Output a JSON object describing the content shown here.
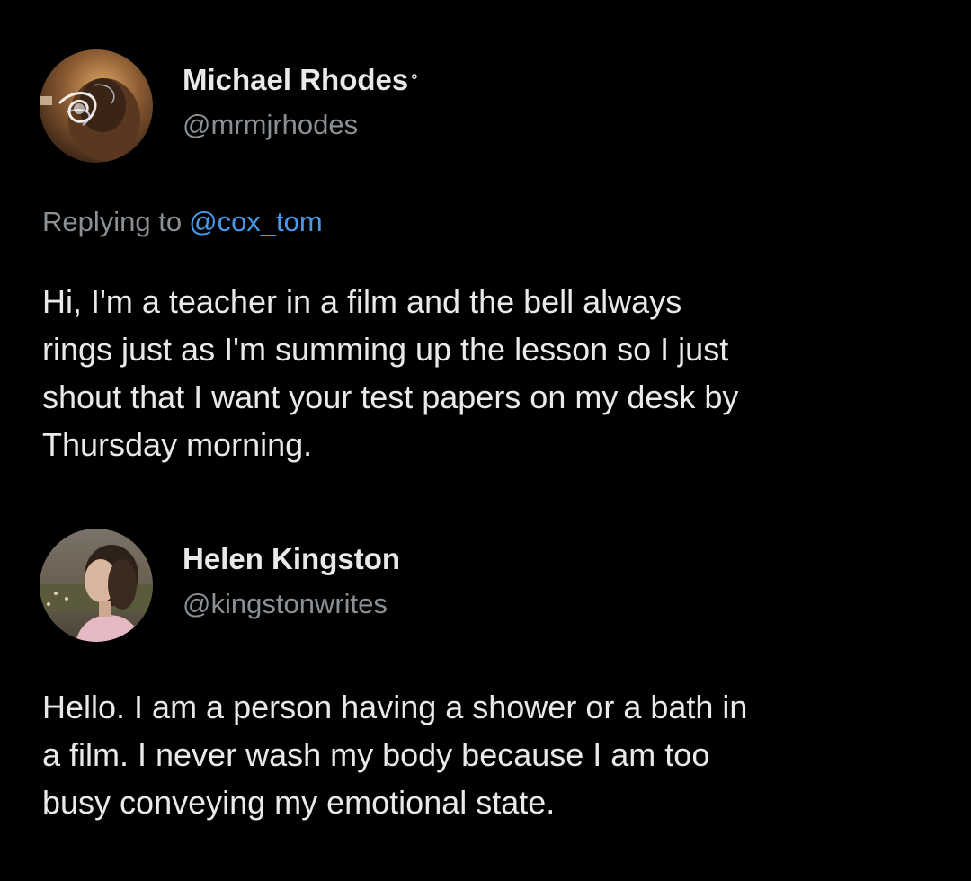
{
  "tweets": [
    {
      "author": {
        "display_name": "Michael Rhodes",
        "name_mark": "°",
        "handle": "@mrmjrhodes",
        "avatar_icon": "avatar-photo-icon"
      },
      "reply": {
        "prefix": "Replying to",
        "mention": "@cox_tom"
      },
      "body_lines": [
        "Hi, I'm a teacher in a film and the bell always",
        "rings just as I'm summing up the lesson so I just",
        "shout that I want your test papers on my desk by",
        "Thursday morning."
      ]
    },
    {
      "author": {
        "display_name": "Helen Kingston",
        "handle": "@kingstonwrites",
        "avatar_icon": "avatar-photo-icon"
      },
      "body_lines": [
        "Hello. I am a person having a shower or a bath in",
        "a film. I never wash my body because I am too",
        "busy conveying my emotional state."
      ]
    }
  ],
  "colors": {
    "background": "#000000",
    "text_primary": "#e7e9ea",
    "text_secondary": "#8b9095",
    "link": "#4a99e9"
  }
}
